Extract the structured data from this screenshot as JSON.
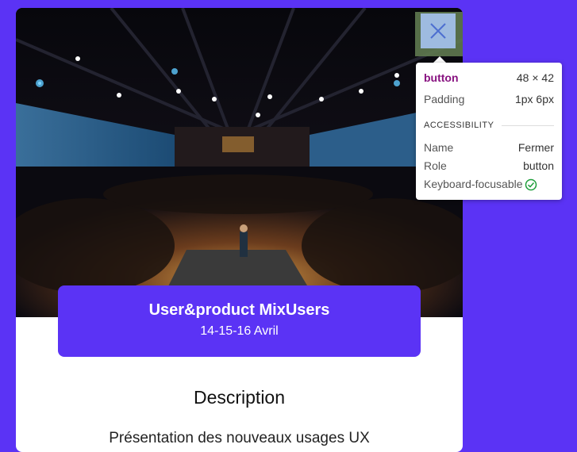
{
  "event": {
    "title": "User&product MixUsers",
    "date": "14-15-16 Avril"
  },
  "description": {
    "heading": "Description",
    "text": "Présentation des nouveaux usages UX"
  },
  "close_button": {
    "icon": "close-icon",
    "label": "Fermer"
  },
  "inspector_tooltip": {
    "element": "button",
    "dimensions": "48 × 42",
    "padding_label": "Padding",
    "padding_value": "1px 6px",
    "section_title": "ACCESSIBILITY",
    "name_label": "Name",
    "name_value": "Fermer",
    "role_label": "Role",
    "role_value": "button",
    "keyboard_label": "Keyboard-focusable",
    "keyboard_icon": "check-circle-icon"
  },
  "colors": {
    "background": "#5b33f5",
    "event_box": "#5b33f5",
    "close_button_highlight": "#9ebbe0",
    "tooltip_element": "#881280",
    "check_green": "#1e9e3a"
  }
}
